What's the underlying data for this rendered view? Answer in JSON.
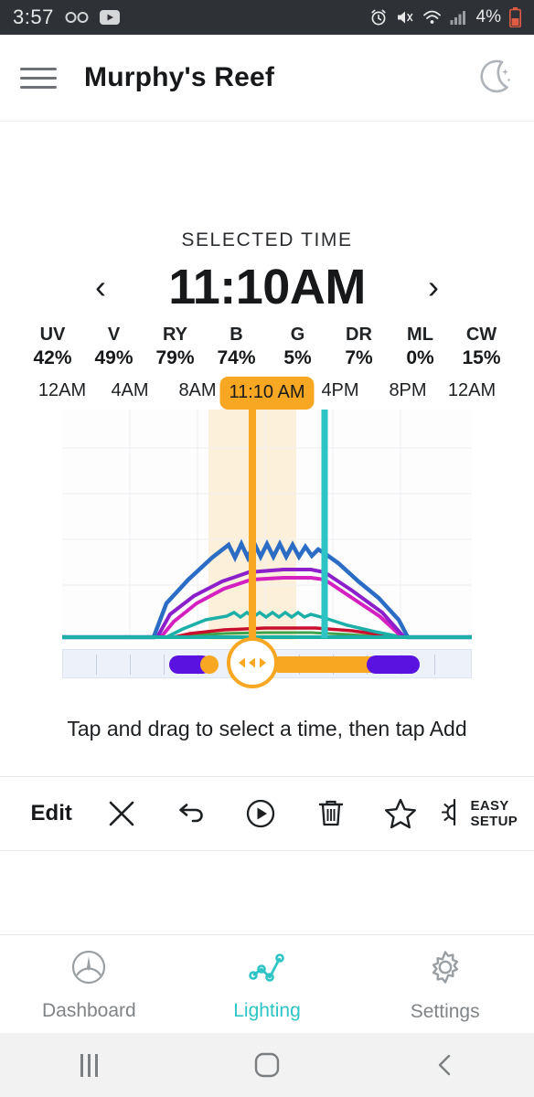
{
  "statusbar": {
    "time": "3:57",
    "battery_text": "4%",
    "icons_left": [
      "voicemail-icon",
      "youtube-icon"
    ],
    "icons_right": [
      "alarm-icon",
      "mute-icon",
      "wifi-icon",
      "signal-icon",
      "battery-icon"
    ]
  },
  "appbar": {
    "menu_icon": "hamburger-menu-icon",
    "title": "Murphy's Reef",
    "right_icon": "moon-icon"
  },
  "selected_time": {
    "label": "SELECTED TIME",
    "value": "11:10AM",
    "prev_icon": "chevron-left-icon",
    "next_icon": "chevron-right-icon"
  },
  "channels": [
    {
      "name": "UV",
      "value": "42%"
    },
    {
      "name": "V",
      "value": "49%"
    },
    {
      "name": "RY",
      "value": "79%"
    },
    {
      "name": "B",
      "value": "74%"
    },
    {
      "name": "G",
      "value": "5%"
    },
    {
      "name": "DR",
      "value": "7%"
    },
    {
      "name": "ML",
      "value": "0%"
    },
    {
      "name": "CW",
      "value": "15%"
    }
  ],
  "chart": {
    "time_badge": "11:10 AM",
    "xticks": [
      "12AM",
      "4AM",
      "8AM",
      "4PM",
      "8PM",
      "12AM"
    ],
    "selection_color": "#F7A722",
    "marker_color": "#2EC4C6"
  },
  "chart_data": {
    "type": "line",
    "title": "",
    "xlabel": "",
    "ylabel": "",
    "grid": true,
    "legend": "none",
    "xlim": [
      0,
      24
    ],
    "ylim": [
      0,
      100
    ],
    "x_tick_labels": [
      "12AM",
      "4AM",
      "8AM",
      "11:10 AM",
      "4PM",
      "8PM",
      "12AM"
    ],
    "x_tick_hours": [
      0,
      4,
      8,
      11.17,
      16,
      20,
      24
    ],
    "selection": {
      "start_hour": 8.7,
      "end_hour": 14.2,
      "cursor_hour": 11.17,
      "marker_hour": 15.4
    },
    "series": [
      {
        "name": "B",
        "color": "#2B6CC4",
        "zigzag": true,
        "x": [
          0,
          5.5,
          6.2,
          7.5,
          9,
          10.5,
          11.5,
          12.5,
          13.5,
          14.6,
          15.4,
          17,
          19,
          20.3,
          21.2
        ],
        "y": [
          0,
          0,
          8,
          27,
          45,
          57,
          58,
          57,
          56,
          55,
          52,
          44,
          34,
          22,
          0
        ]
      },
      {
        "name": "UV",
        "color": "#8B1FC9",
        "zigzag": false,
        "x": [
          0,
          5.5,
          6.4,
          8,
          10.5,
          12.5,
          14.5,
          15.4,
          17.5,
          19.5,
          21.2
        ],
        "y": [
          0,
          0,
          5,
          17,
          32,
          37,
          37,
          36,
          27,
          16,
          0
        ]
      },
      {
        "name": "V",
        "color": "#D420C0",
        "zigzag": false,
        "x": [
          0,
          5.8,
          6.6,
          8.3,
          10.8,
          12.8,
          14.6,
          15.4,
          17.6,
          19.6,
          21.2
        ],
        "y": [
          0,
          0,
          3,
          12,
          26,
          32,
          32,
          31,
          21,
          11,
          0
        ]
      },
      {
        "name": "CW",
        "color": "#1BAFA8",
        "zigzag": true,
        "x": [
          0,
          6.2,
          7.2,
          9,
          10.8,
          12.5,
          14.2,
          15.4,
          17.5,
          19.5,
          21.2
        ],
        "y": [
          0,
          0,
          2,
          7,
          11,
          11,
          11,
          10,
          7,
          4,
          0
        ]
      },
      {
        "name": "DR",
        "color": "#C8102E",
        "zigzag": false,
        "x": [
          0,
          6.5,
          7.5,
          9.5,
          11.5,
          13.5,
          15.4,
          17.5,
          19.5,
          21.2
        ],
        "y": [
          0,
          0,
          1,
          3,
          5,
          5,
          5,
          3,
          2,
          0
        ]
      },
      {
        "name": "G",
        "color": "#3FA34D",
        "zigzag": false,
        "x": [
          0,
          6.8,
          8,
          10,
          12,
          14,
          15.4,
          17.5,
          19.5,
          21.2
        ],
        "y": [
          0,
          0,
          1,
          2,
          3,
          3,
          3,
          2,
          1,
          0
        ]
      },
      {
        "name": "baseline",
        "color": "#1BAFA8",
        "zigzag": false,
        "x": [
          0,
          24
        ],
        "y": [
          0,
          0
        ]
      }
    ]
  },
  "timeline": {
    "markers": [
      {
        "name": "sunrise-block",
        "color": "#5A12E0",
        "start_pct": 26,
        "width_pct": 9
      },
      {
        "name": "sunrise-dot",
        "color": "#F7A722",
        "start_pct": 33,
        "width_pct": 4
      },
      {
        "name": "daylight-block",
        "color": "#F7A722",
        "start_pct": 51,
        "width_pct": 25
      },
      {
        "name": "sunset-block",
        "color": "#5A12E0",
        "start_pct": 82,
        "width_pct": 12
      }
    ],
    "handle_icon": "drag-left-right-icon"
  },
  "hint": "Tap and drag to select a time, then tap Add",
  "toolbar": {
    "edit_label": "Edit",
    "items": [
      {
        "name": "close-icon",
        "label": ""
      },
      {
        "name": "undo-icon",
        "label": ""
      },
      {
        "name": "play-icon",
        "label": ""
      },
      {
        "name": "trash-icon",
        "label": ""
      },
      {
        "name": "star-icon",
        "label": ""
      }
    ],
    "easy_setup_line1": "EASY",
    "easy_setup_line2": "SETUP",
    "easy_setup_icon": "brightness-icon"
  },
  "bottomnav": {
    "items": [
      {
        "label": "Dashboard",
        "icon": "gauge-icon",
        "active": false
      },
      {
        "label": "Lighting",
        "icon": "line-chart-icon",
        "active": true
      },
      {
        "label": "Settings",
        "icon": "gear-icon",
        "active": false
      }
    ],
    "active_color": "#2EC4C6"
  },
  "androidnav": {
    "recents": "recents-icon",
    "home": "home-icon",
    "back": "back-icon"
  }
}
